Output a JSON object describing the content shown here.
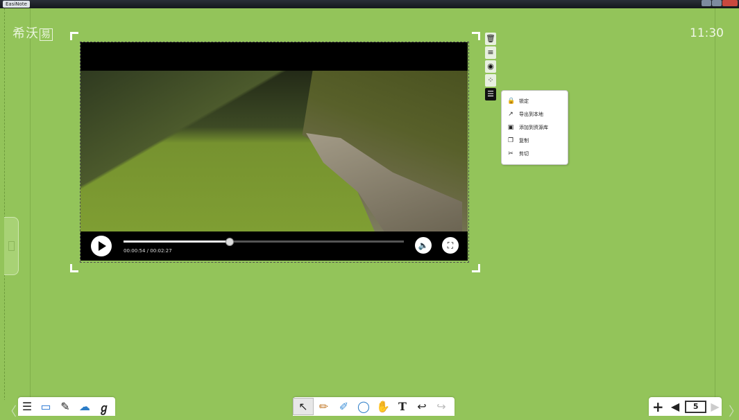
{
  "window": {
    "app_name": "EasiNote"
  },
  "header": {
    "logo_text": "希沃",
    "logo_badge": "易",
    "clock": "11:30"
  },
  "video": {
    "current_time": "00:00:54",
    "duration": "00:02:27",
    "time_display": "00:00:54 / 00:02:27",
    "progress": 0.378
  },
  "side_toolbar": {
    "items": [
      {
        "icon": "trash-icon",
        "glyph": "🗑"
      },
      {
        "icon": "align-icon",
        "glyph": "≡"
      },
      {
        "icon": "camera-icon",
        "glyph": "◉"
      },
      {
        "icon": "effects-icon",
        "glyph": "⁘"
      },
      {
        "icon": "menu-icon",
        "glyph": "☰"
      }
    ]
  },
  "context_menu": {
    "items": [
      {
        "label": "锁定",
        "icon": "lock-icon",
        "glyph": "🔒"
      },
      {
        "label": "导出到本地",
        "icon": "export-icon",
        "glyph": "↗"
      },
      {
        "label": "添加到资源库",
        "icon": "library-icon",
        "glyph": "▣"
      },
      {
        "label": "复制",
        "icon": "copy-icon",
        "glyph": "❐"
      },
      {
        "label": "剪切",
        "icon": "scissors-icon",
        "glyph": "✂"
      }
    ]
  },
  "bottom_toolbar": {
    "left": [
      "☰",
      "▭",
      "✎",
      "☁",
      "ℊ"
    ],
    "center": [
      "↖",
      "✏",
      "✐",
      "◯",
      "✋",
      "T",
      "↩",
      "↪"
    ],
    "right": [
      "+",
      "◀",
      "5",
      "▶"
    ]
  },
  "page_indicator": "5"
}
